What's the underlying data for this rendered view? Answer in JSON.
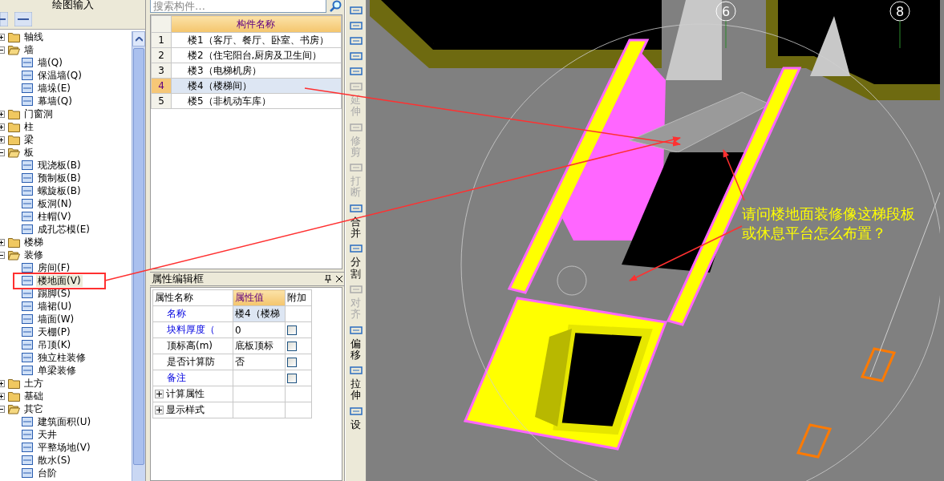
{
  "panel_title": "绘图输入",
  "tree": [
    {
      "label": "轴线",
      "expanded": false,
      "selected": false
    },
    {
      "label": "墙",
      "expanded": true,
      "selected": false,
      "children": [
        {
          "label": "墙(Q)",
          "selected": false
        },
        {
          "label": "保温墙(Q)",
          "selected": false
        },
        {
          "label": "墙垛(E)",
          "selected": false
        },
        {
          "label": "幕墙(Q)",
          "selected": false
        }
      ]
    },
    {
      "label": "门窗洞",
      "expanded": false,
      "selected": false
    },
    {
      "label": "柱",
      "expanded": false,
      "selected": false
    },
    {
      "label": "梁",
      "expanded": false,
      "selected": false
    },
    {
      "label": "板",
      "expanded": true,
      "selected": false,
      "children": [
        {
          "label": "现浇板(B)",
          "selected": false
        },
        {
          "label": "预制板(B)",
          "selected": false
        },
        {
          "label": "螺旋板(B)",
          "selected": false
        },
        {
          "label": "板洞(N)",
          "selected": false
        },
        {
          "label": "柱帽(V)",
          "selected": false
        },
        {
          "label": "成孔芯模(E)",
          "selected": false
        }
      ]
    },
    {
      "label": "楼梯",
      "expanded": false,
      "selected": false
    },
    {
      "label": "装修",
      "expanded": true,
      "selected": false,
      "children": [
        {
          "label": "房间(F)",
          "selected": false
        },
        {
          "label": "楼地面(V)",
          "selected": true
        },
        {
          "label": "踢脚(S)",
          "selected": false
        },
        {
          "label": "墙裙(U)",
          "selected": false
        },
        {
          "label": "墙面(W)",
          "selected": false
        },
        {
          "label": "天棚(P)",
          "selected": false
        },
        {
          "label": "吊顶(K)",
          "selected": false
        },
        {
          "label": "独立柱装修",
          "selected": false
        },
        {
          "label": "单梁装修",
          "selected": false
        }
      ]
    },
    {
      "label": "土方",
      "expanded": false,
      "selected": false
    },
    {
      "label": "基础",
      "expanded": false,
      "selected": false
    },
    {
      "label": "其它",
      "expanded": true,
      "selected": false,
      "children": [
        {
          "label": "建筑面积(U)",
          "selected": false
        },
        {
          "label": "天井",
          "selected": false
        },
        {
          "label": "平整场地(V)",
          "selected": false
        },
        {
          "label": "散水(S)",
          "selected": false
        },
        {
          "label": "台阶",
          "selected": false
        }
      ]
    }
  ],
  "search": {
    "placeholder": "搜索构件…"
  },
  "component_table": {
    "columns": [
      "构件名称"
    ],
    "rows": [
      {
        "index": "1",
        "name": "楼1（客厅、餐厅、卧室、书房）",
        "selected": false
      },
      {
        "index": "2",
        "name": "楼2（住宅阳台,厨房及卫生间）",
        "selected": false
      },
      {
        "index": "3",
        "name": "楼3（电梯机房）",
        "selected": false
      },
      {
        "index": "4",
        "name": "楼4（楼梯间）",
        "selected": true
      },
      {
        "index": "5",
        "name": "楼5（非机动车库）",
        "selected": false
      }
    ]
  },
  "properties": {
    "title": "属性编辑框",
    "columns": [
      "属性名称",
      "属性值",
      "附加"
    ],
    "rows": [
      {
        "kind": "name",
        "name": "名称",
        "value": "楼4（楼梯",
        "public": true
      },
      {
        "kind": "check",
        "name": "块料厚度（",
        "value": "0",
        "public": true,
        "checked": false
      },
      {
        "kind": "check",
        "name": "顶标高(m)",
        "value": "底板顶标",
        "public": false,
        "checked": false
      },
      {
        "kind": "check",
        "name": "是否计算防",
        "value": "否",
        "public": false,
        "checked": false
      },
      {
        "kind": "check",
        "name": "备注",
        "public": true,
        "checked": false
      },
      {
        "kind": "group",
        "name": "计算属性",
        "expanded": false
      },
      {
        "kind": "group",
        "name": "显示样式",
        "expanded": false
      }
    ]
  },
  "toolbar": [
    {
      "disabled": false
    },
    {
      "disabled": false
    },
    {
      "disabled": false
    },
    {
      "disabled": false
    },
    {
      "disabled": false
    },
    {
      "label": "延伸",
      "disabled": true
    },
    {
      "label": "修剪",
      "disabled": true
    },
    {
      "label": "打断",
      "disabled": true
    },
    {
      "label": "合并",
      "disabled": false
    },
    {
      "label": "分割",
      "disabled": false
    },
    {
      "label": "对齐",
      "disabled": true
    },
    {
      "label": "偏移",
      "disabled": false
    },
    {
      "label": "拉伸",
      "disabled": false
    },
    {
      "label": "设",
      "disabled": false
    }
  ],
  "canvas": {
    "axis_labels": [
      "6",
      "8"
    ],
    "note": "请问楼地面装修像这梯段板或休息平台怎么布置？"
  }
}
